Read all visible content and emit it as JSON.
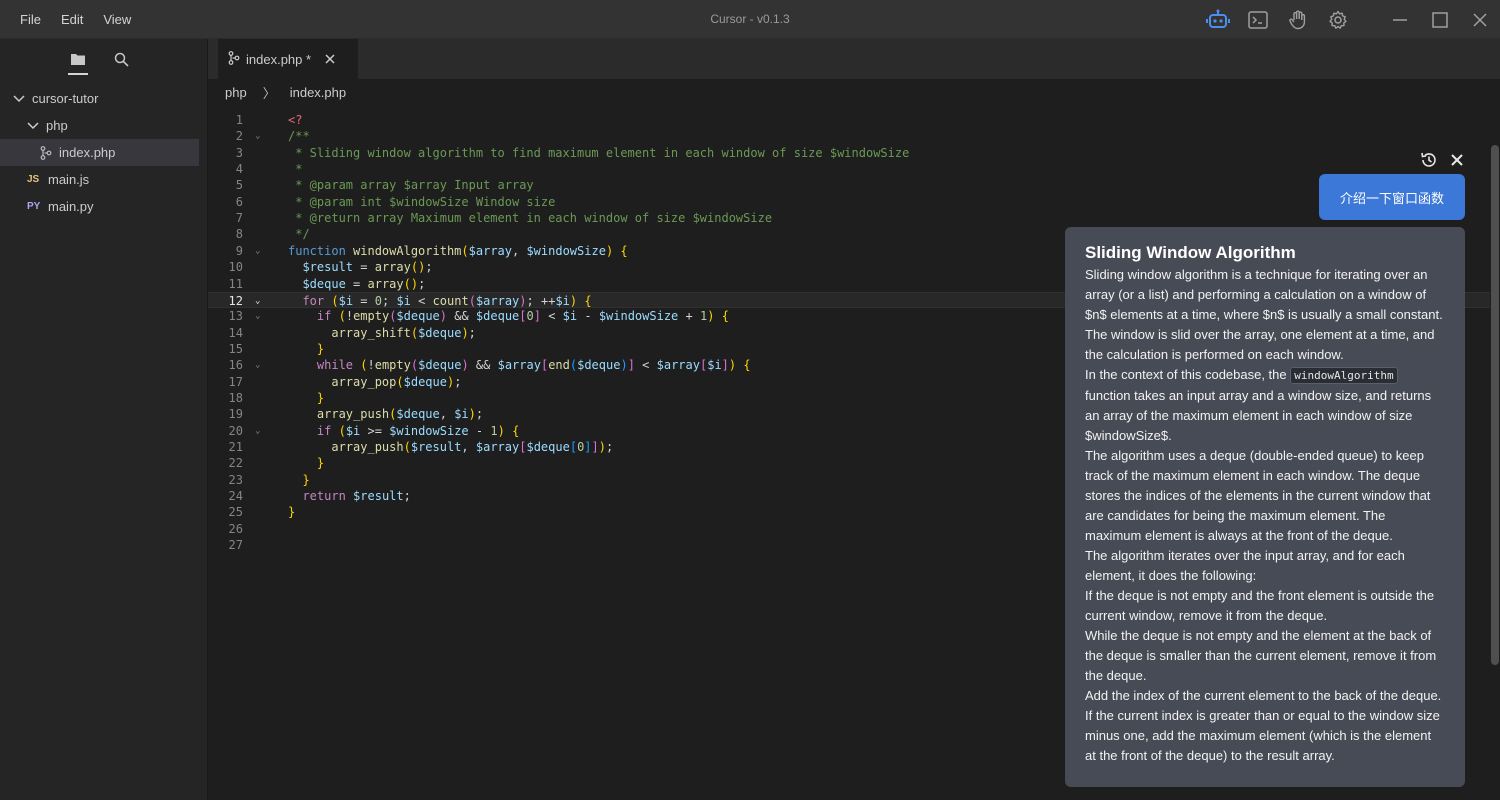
{
  "menu": [
    "File",
    "Edit",
    "View"
  ],
  "app_title": "Cursor - v0.1.3",
  "sidebar": {
    "tree": [
      {
        "label": "cursor-tutor",
        "type": "folder",
        "depth": 0
      },
      {
        "label": "php",
        "type": "folder",
        "depth": 1
      },
      {
        "label": "index.php",
        "type": "file",
        "depth": 2,
        "selected": true
      },
      {
        "label": "main.js",
        "type": "file",
        "depth": 1,
        "badge": "JS"
      },
      {
        "label": "main.py",
        "type": "file",
        "depth": 1,
        "badge": "PY"
      }
    ]
  },
  "editor": {
    "tab_label": "index.php *",
    "breadcrumb": [
      "php",
      "index.php"
    ],
    "current_line": 12
  },
  "code_lines": [
    "<?",
    "/**",
    " * Sliding window algorithm to find maximum element in each window of size $windowSize",
    " *",
    " * @param array $array Input array",
    " * @param int $windowSize Window size",
    " * @return array Maximum element in each window of size $windowSize",
    " */",
    "function windowAlgorithm($array, $windowSize) {",
    "  $result = array();",
    "  $deque = array();",
    "  for ($i = 0; $i < count($array); ++$i) {",
    "    if (!empty($deque) && $deque[0] < $i - $windowSize + 1) {",
    "      array_shift($deque);",
    "    }",
    "    while (!empty($deque) && $array[end($deque)] < $array[$i]) {",
    "      array_pop($deque);",
    "    }",
    "    array_push($deque, $i);",
    "    if ($i >= $windowSize - 1) {",
    "      array_push($result, $array[$deque[0]]);",
    "    }",
    "  }",
    "  return $result;",
    "}",
    "",
    ""
  ],
  "fold_lines": [
    2,
    9,
    12,
    13,
    16,
    20
  ],
  "chat": {
    "prompt": "介绍一下窗口函数",
    "answer_title": "Sliding Window Algorithm",
    "p1": "Sliding window algorithm is a technique for iterating over an array (or a list) and performing a calculation on a window of $n$ elements at a time, where $n$ is usually a small constant. The window is slid over the array, one element at a time, and the calculation is performed on each window.",
    "p2_before": "In the context of this codebase, the ",
    "p2_code": "windowAlgorithm",
    "p2_after": " function takes an input array and a window size, and returns an array of the maximum element in each window of size $windowSize$.",
    "p3": "The algorithm uses a deque (double-ended queue) to keep track of the maximum element in each window. The deque stores the indices of the elements in the current window that are candidates for being the maximum element. The maximum element is always at the front of the deque.",
    "p4": "The algorithm iterates over the input array, and for each element, it does the following:",
    "p5": "If the deque is not empty and the front element is outside the current window, remove it from the deque.",
    "p6": "While the deque is not empty and the element at the back of the deque is smaller than the current element, remove it from the deque.",
    "p7": "Add the index of the current element to the back of the deque.",
    "p8": "If the current index is greater than or equal to the window size minus one, add the maximum element (which is the element at the front of the deque) to the result array."
  },
  "icons": {
    "titlebar": [
      "robot-icon",
      "terminal-icon",
      "hand-icon",
      "settings-gear-icon"
    ],
    "window_controls": [
      "minimize-icon",
      "maximize-icon",
      "close-icon"
    ]
  },
  "colors": {
    "accent": "#3c78d8",
    "answer_bg": "#474b55",
    "editor_bg": "#1e1e1e",
    "sidebar_bg": "#252526"
  }
}
